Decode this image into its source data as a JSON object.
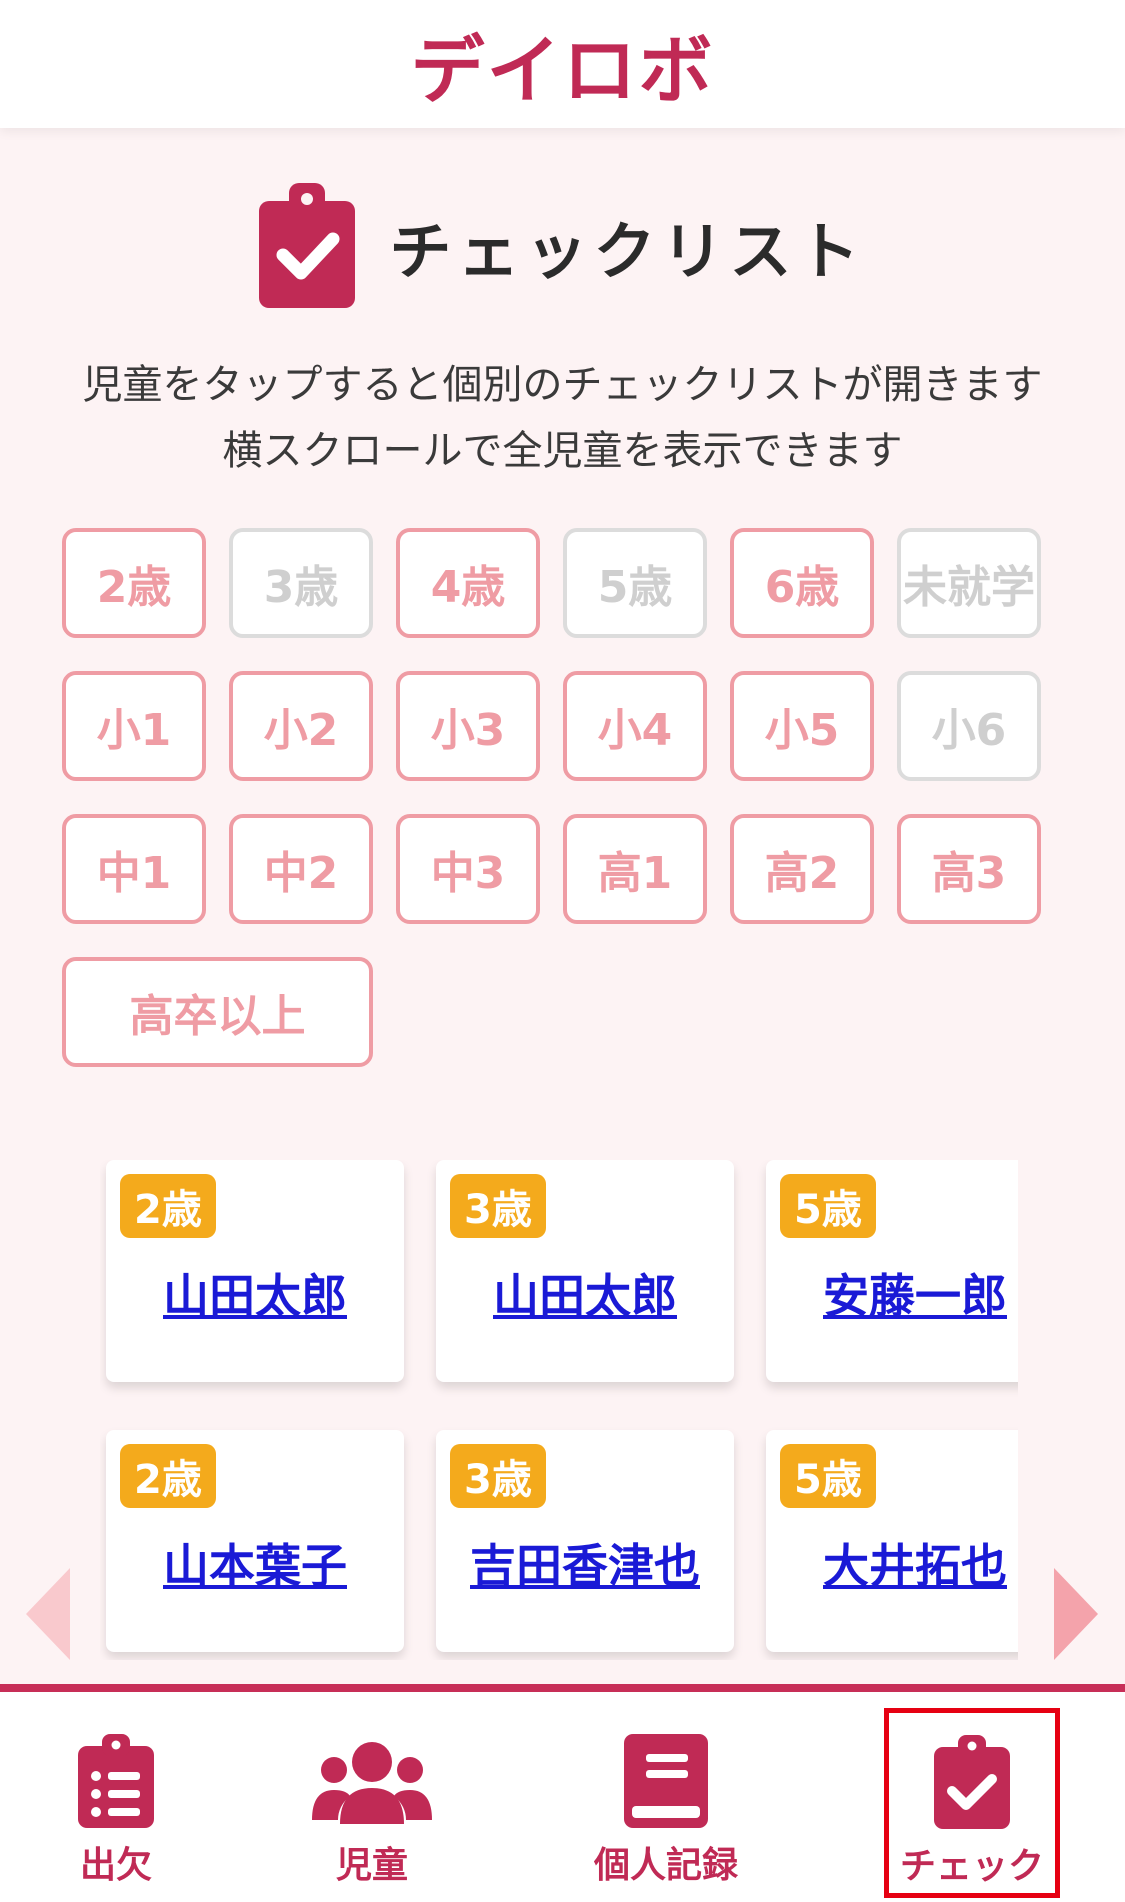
{
  "header": {
    "title": "デイロボ"
  },
  "page": {
    "title": "チェックリスト",
    "description_line1": "児童をタップすると個別のチェックリストが開きます",
    "description_line2": "横スクロールで全児童を表示できます"
  },
  "filters": [
    {
      "label": "2歳",
      "active": true
    },
    {
      "label": "3歳",
      "active": false
    },
    {
      "label": "4歳",
      "active": true
    },
    {
      "label": "5歳",
      "active": false
    },
    {
      "label": "6歳",
      "active": true
    },
    {
      "label": "未就学",
      "active": false
    },
    {
      "label": "小1",
      "active": true
    },
    {
      "label": "小2",
      "active": true
    },
    {
      "label": "小3",
      "active": true
    },
    {
      "label": "小4",
      "active": true
    },
    {
      "label": "小5",
      "active": true
    },
    {
      "label": "小6",
      "active": false
    },
    {
      "label": "中1",
      "active": true
    },
    {
      "label": "中2",
      "active": true
    },
    {
      "label": "中3",
      "active": true
    },
    {
      "label": "高1",
      "active": true
    },
    {
      "label": "高2",
      "active": true
    },
    {
      "label": "高3",
      "active": true
    },
    {
      "label": "高卒以上",
      "active": true
    }
  ],
  "children": [
    {
      "age": "2歳",
      "name": "山田太郎"
    },
    {
      "age": "3歳",
      "name": "山田太郎"
    },
    {
      "age": "5歳",
      "name": "安藤一郎"
    },
    {
      "age": "2歳",
      "name": "山本葉子"
    },
    {
      "age": "3歳",
      "name": "吉田香津也"
    },
    {
      "age": "5歳",
      "name": "大井拓也"
    }
  ],
  "nav": {
    "attendance": "出欠",
    "children": "児童",
    "records": "個人記録",
    "check": "チェック"
  },
  "colors": {
    "brand": "#c02a55",
    "chip_active": "#ef9ca4",
    "chip_inactive": "#dcdcdc",
    "age_badge": "#f4aa1c",
    "name_link": "#1a1ad6",
    "highlight": "#e60012"
  }
}
